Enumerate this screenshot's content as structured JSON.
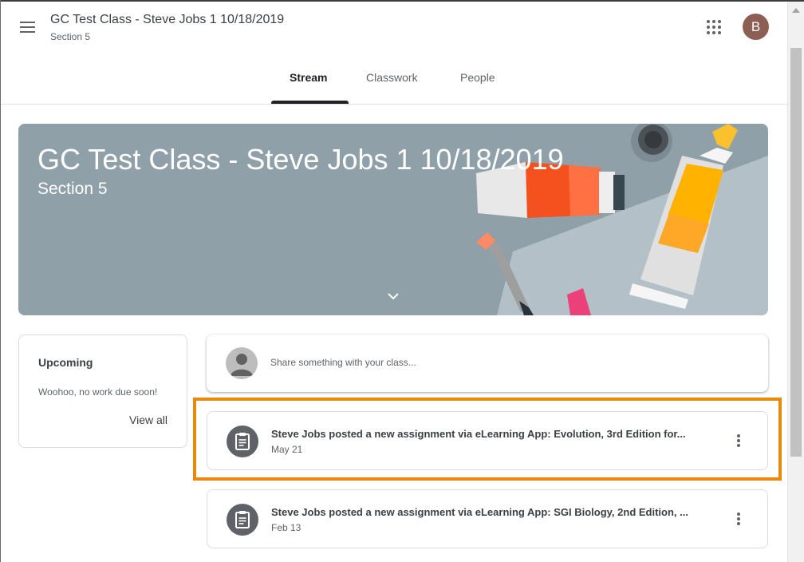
{
  "header": {
    "class_name": "GC Test Class - Steve Jobs 1 10/18/2019",
    "section": "Section 5",
    "avatar_letter": "B",
    "avatar_color": "#8d5f54"
  },
  "tabs": [
    {
      "label": "Stream",
      "active": true
    },
    {
      "label": "Classwork",
      "active": false
    },
    {
      "label": "People",
      "active": false
    }
  ],
  "banner": {
    "title": "GC Test Class - Steve Jobs 1 10/18/2019",
    "subtitle": "Section 5",
    "background": "#8fa0a9",
    "icon": "chevron-down-icon"
  },
  "upcoming": {
    "title": "Upcoming",
    "message": "Woohoo, no work due soon!",
    "link": "View all"
  },
  "share": {
    "placeholder": "Share something with your class..."
  },
  "posts": [
    {
      "text": "Steve Jobs posted a new assignment via eLearning App: Evolution, 3rd Edition for...",
      "date": "May 21",
      "icon": "assignment-icon",
      "highlighted": true
    },
    {
      "text": "Steve Jobs posted a new assignment via eLearning App: SGI Biology, 2nd Edition, ...",
      "date": "Feb 13",
      "icon": "assignment-icon",
      "highlighted": false
    }
  ],
  "colors": {
    "highlight": "#e8880c",
    "active_tab": "#202124"
  }
}
